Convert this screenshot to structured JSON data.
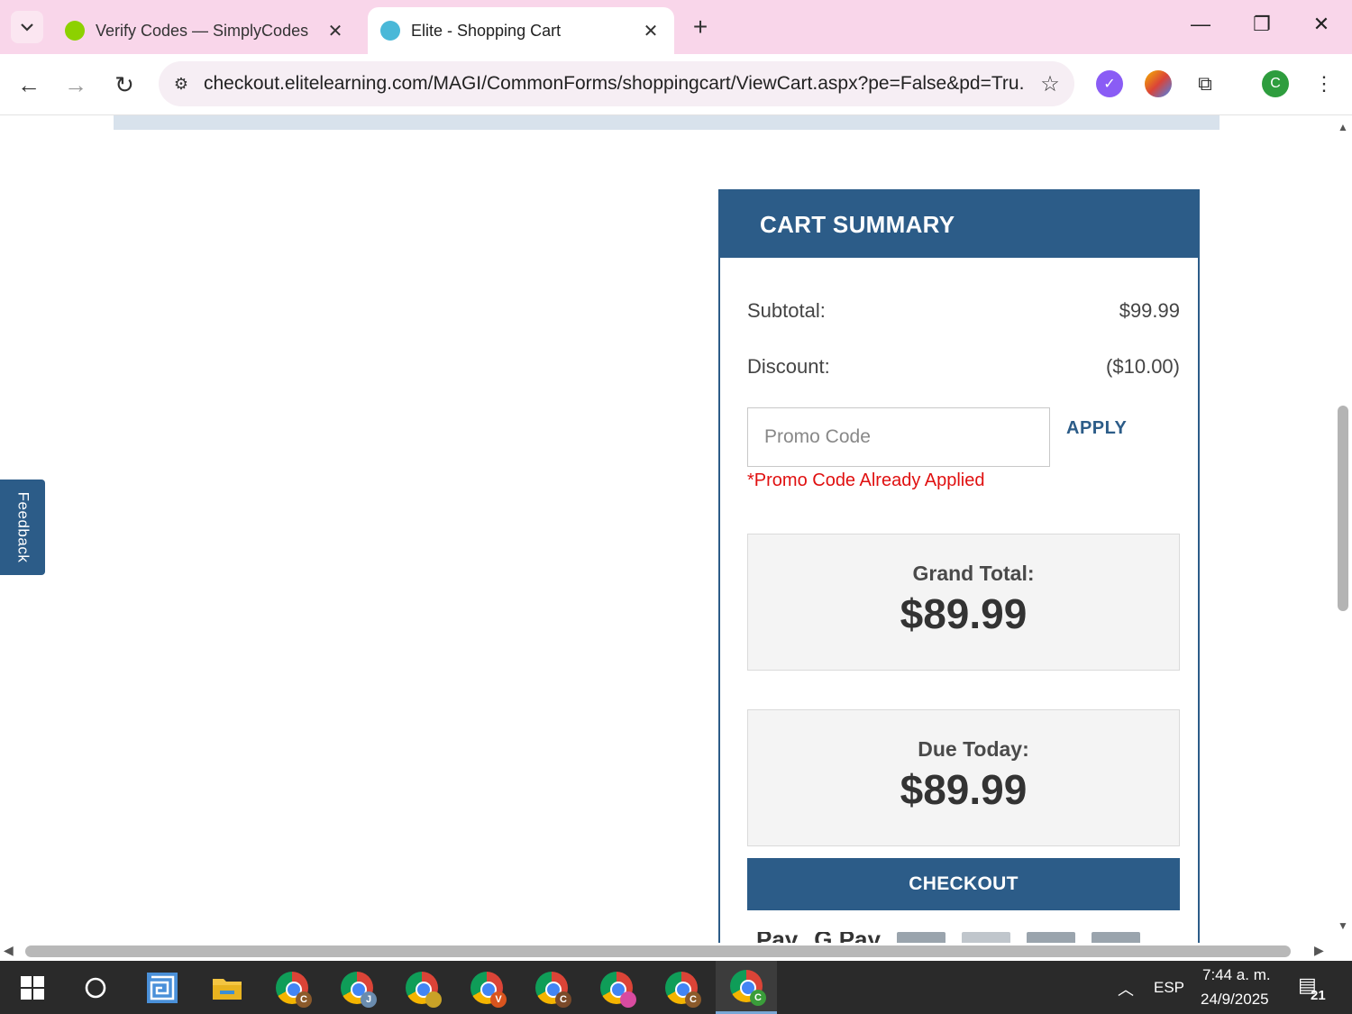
{
  "browser": {
    "tabs": [
      {
        "title": "Verify Codes — SimplyCodes",
        "active": false,
        "favicon_color": "#8dd100"
      },
      {
        "title": "Elite - Shopping Cart",
        "active": true,
        "favicon_color": "#4ab8d8"
      }
    ],
    "url": "checkout.elitelearning.com/MAGI/CommonForms/shoppingcart/ViewCart.aspx?pe=False&pd=Tru...",
    "profile_initial": "C"
  },
  "feedback": {
    "label": "Feedback"
  },
  "cart": {
    "header": "CART SUMMARY",
    "subtotal_label": "Subtotal:",
    "subtotal_value": "$99.99",
    "discount_label": "Discount:",
    "discount_value": "($10.00)",
    "promo_placeholder": "Promo Code",
    "apply_label": "APPLY",
    "promo_error": "*Promo Code Already Applied",
    "grand_total_label": "Grand Total:",
    "grand_total_value": "$89.99",
    "due_today_label": "Due Today:",
    "due_today_value": "$89.99",
    "checkout_label": "CHECKOUT",
    "pay_methods": [
      "Apple Pay",
      "Google Pay",
      "Visa",
      "Mastercard",
      "Discover",
      "American Express"
    ]
  },
  "taskbar": {
    "chrome_badges": [
      {
        "letter": "C",
        "color": "#8b5a2b"
      },
      {
        "letter": "J",
        "color": "#6a8caf"
      },
      {
        "letter": "",
        "color": "#c9a227"
      },
      {
        "letter": "V",
        "color": "#d9541e"
      },
      {
        "letter": "C",
        "color": "#7a4a2a"
      },
      {
        "letter": "",
        "color": "#d94ba0"
      },
      {
        "letter": "C",
        "color": "#8b5a2b"
      },
      {
        "letter": "C",
        "color": "#3a9d3a"
      }
    ],
    "language": "ESP",
    "time": "7:44 a. m.",
    "date": "24/9/2025",
    "notifications": "21"
  }
}
